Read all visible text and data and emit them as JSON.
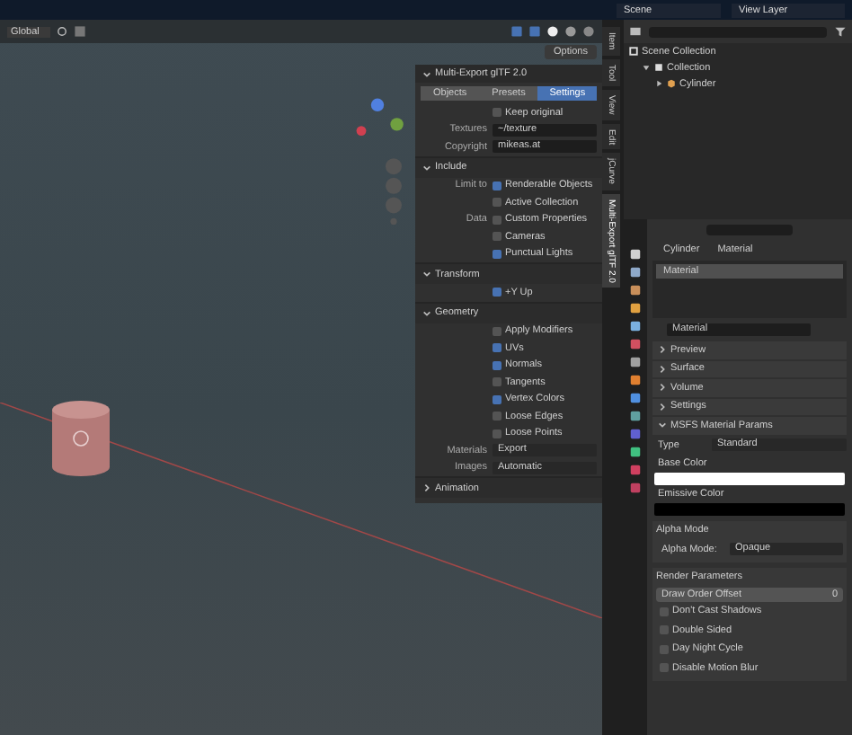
{
  "topbar": {
    "scene": "Scene",
    "view_layer": "View Layer"
  },
  "viewport": {
    "orientation": "Global",
    "options": "Options"
  },
  "n_panel": {
    "title": "Multi-Export glTF 2.0",
    "expanded": true,
    "tabs": [
      {
        "label": "Objects",
        "selected": false
      },
      {
        "label": "Presets",
        "selected": false
      },
      {
        "label": "Settings",
        "selected": true
      }
    ],
    "rows": [
      {
        "kind": "checkbox",
        "text": "Keep original",
        "checked": false
      },
      {
        "kind": "field",
        "label": "Textures",
        "value": "~/texture"
      },
      {
        "kind": "field",
        "label": "Copyright",
        "value": "mikeas.at"
      }
    ],
    "sections": [
      {
        "title": "Include",
        "expanded": true,
        "rows": [
          {
            "kind": "checkbox",
            "label": "Limit to",
            "text": "Renderable Objects",
            "checked": true
          },
          {
            "kind": "checkbox",
            "text": "Active Collection",
            "checked": false
          },
          {
            "kind": "checkbox",
            "label": "Data",
            "text": "Custom Properties",
            "checked": false
          },
          {
            "kind": "checkbox",
            "text": "Cameras",
            "checked": false
          },
          {
            "kind": "checkbox",
            "text": "Punctual Lights",
            "checked": true
          }
        ]
      },
      {
        "title": "Transform",
        "expanded": true,
        "rows": [
          {
            "kind": "checkbox",
            "text": "+Y Up",
            "checked": true
          }
        ]
      },
      {
        "title": "Geometry",
        "expanded": true,
        "rows": [
          {
            "kind": "checkbox",
            "text": "Apply Modifiers",
            "checked": false
          },
          {
            "kind": "checkbox",
            "text": "UVs",
            "checked": true
          },
          {
            "kind": "checkbox",
            "text": "Normals",
            "checked": true
          },
          {
            "kind": "checkbox",
            "text": "Tangents",
            "checked": false
          },
          {
            "kind": "checkbox",
            "text": "Vertex Colors",
            "checked": true
          },
          {
            "kind": "checkbox",
            "text": "Loose Edges",
            "checked": false
          },
          {
            "kind": "checkbox",
            "text": "Loose Points",
            "checked": false
          },
          {
            "kind": "dropdown",
            "label": "Materials",
            "value": "Export"
          },
          {
            "kind": "dropdown",
            "label": "Images",
            "value": "Automatic"
          }
        ]
      },
      {
        "title": "Animation",
        "expanded": false
      }
    ]
  },
  "side_tabs": [
    {
      "label": "Item",
      "selected": false
    },
    {
      "label": "Tool",
      "selected": false
    },
    {
      "label": "View",
      "selected": false
    },
    {
      "label": "Edit",
      "selected": false
    },
    {
      "label": "jCurve",
      "selected": false
    },
    {
      "label": "Multi-Export glTF 2.0",
      "selected": true
    }
  ],
  "outliner": {
    "tree": [
      {
        "name": "Scene Collection",
        "kind": "scene",
        "children": [
          {
            "name": "Collection",
            "kind": "collection",
            "expanded": true,
            "children": [
              {
                "name": "Cylinder",
                "kind": "object",
                "expanded": false
              }
            ]
          }
        ]
      }
    ]
  },
  "properties": {
    "breadcrumb": [
      "Cylinder",
      "Material"
    ],
    "slots": [
      {
        "name": "Material",
        "selected": true
      }
    ],
    "material": "Material",
    "panels": [
      {
        "title": "Preview",
        "expanded": false
      },
      {
        "title": "Surface",
        "expanded": false
      },
      {
        "title": "Volume",
        "expanded": false
      },
      {
        "title": "Settings",
        "expanded": false
      },
      {
        "title": "MSFS Material Params",
        "expanded": true
      }
    ],
    "type_label": "Type",
    "type_value": "Standard",
    "colors": [
      {
        "label": "Base Color",
        "color": "#ffffff"
      },
      {
        "label": "Emissive Color",
        "color": "#000000"
      }
    ],
    "alpha": {
      "title": "Alpha Mode",
      "label": "Alpha Mode:",
      "value": "Opaque"
    },
    "render": {
      "title": "Render Parameters",
      "offset_label": "Draw Order Offset",
      "offset_value": "0",
      "options": [
        {
          "text": "Don't Cast Shadows",
          "checked": false
        },
        {
          "text": "Double Sided",
          "checked": false
        },
        {
          "text": "Day Night Cycle",
          "checked": false
        },
        {
          "text": "Disable Motion Blur",
          "checked": false
        }
      ]
    }
  }
}
